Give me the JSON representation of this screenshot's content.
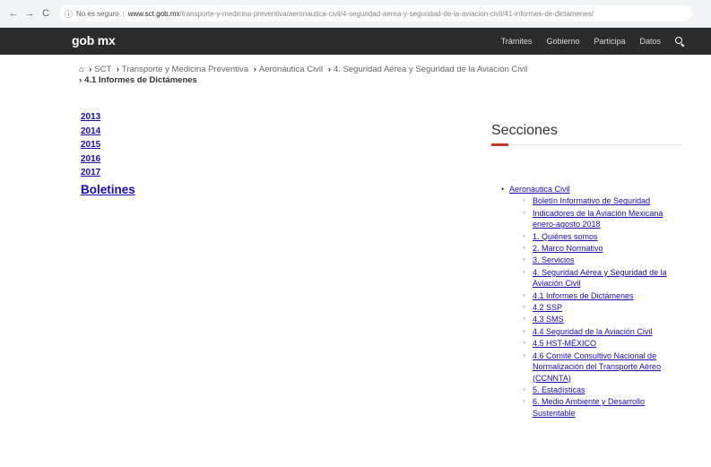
{
  "browser": {
    "back_icon": "←",
    "forward_icon": "→",
    "reload_icon": "C",
    "info_icon": "ⓘ",
    "insecure_label": "No es seguro",
    "separator": "|",
    "url_domain": "www.sct.gob.mx",
    "url_path": "/transporte-y-medicina-preventiva/aeronautica-civil/4-seguridad-aerea-y-seguridad-de-la-aviacion-civil/41-informes-de-dictamenes/"
  },
  "nav": {
    "logo": "gob mx",
    "items": [
      "Trámites",
      "Gobierno",
      "Participa",
      "Datos"
    ]
  },
  "breadcrumb": {
    "home_icon": "⌂",
    "caret": "›",
    "items": [
      "SCT",
      "Transporte y Medicina Preventiva",
      "Aeronáutica Civil",
      "4. Seguridad Aérea y Seguridad de la Aviación Civil"
    ],
    "current": "4.1 Informes de Dictámenes"
  },
  "years": [
    "2013",
    "2014",
    "2015",
    "2016",
    "2017"
  ],
  "boletines": "Boletines",
  "secciones": {
    "title": "Secciones",
    "parent": "Aeronáutica Civil",
    "items": [
      "Boletín Informativo de Seguridad",
      "Indicadores de la Aviación Mexicana enero-agosto 2018",
      "1. Quiénes somos",
      "2. Marco Normativo",
      "3. Servicios",
      "4. Seguridad Aérea y Seguridad de la Aviación Civil",
      "4.1 Informes de Dictámenes",
      "4.2 SSP",
      "4.3 SMS",
      "4.4 Seguridad de la Aviación Civil",
      "4.5 HST-MÉXICO",
      "4.6 Comité Consultivo Nacional de Normalización del Transporte Aéreo (CCNNTA)",
      "5. Estadísticas",
      "6. Medio Ambiente y Desarrollo Sustentable"
    ]
  }
}
